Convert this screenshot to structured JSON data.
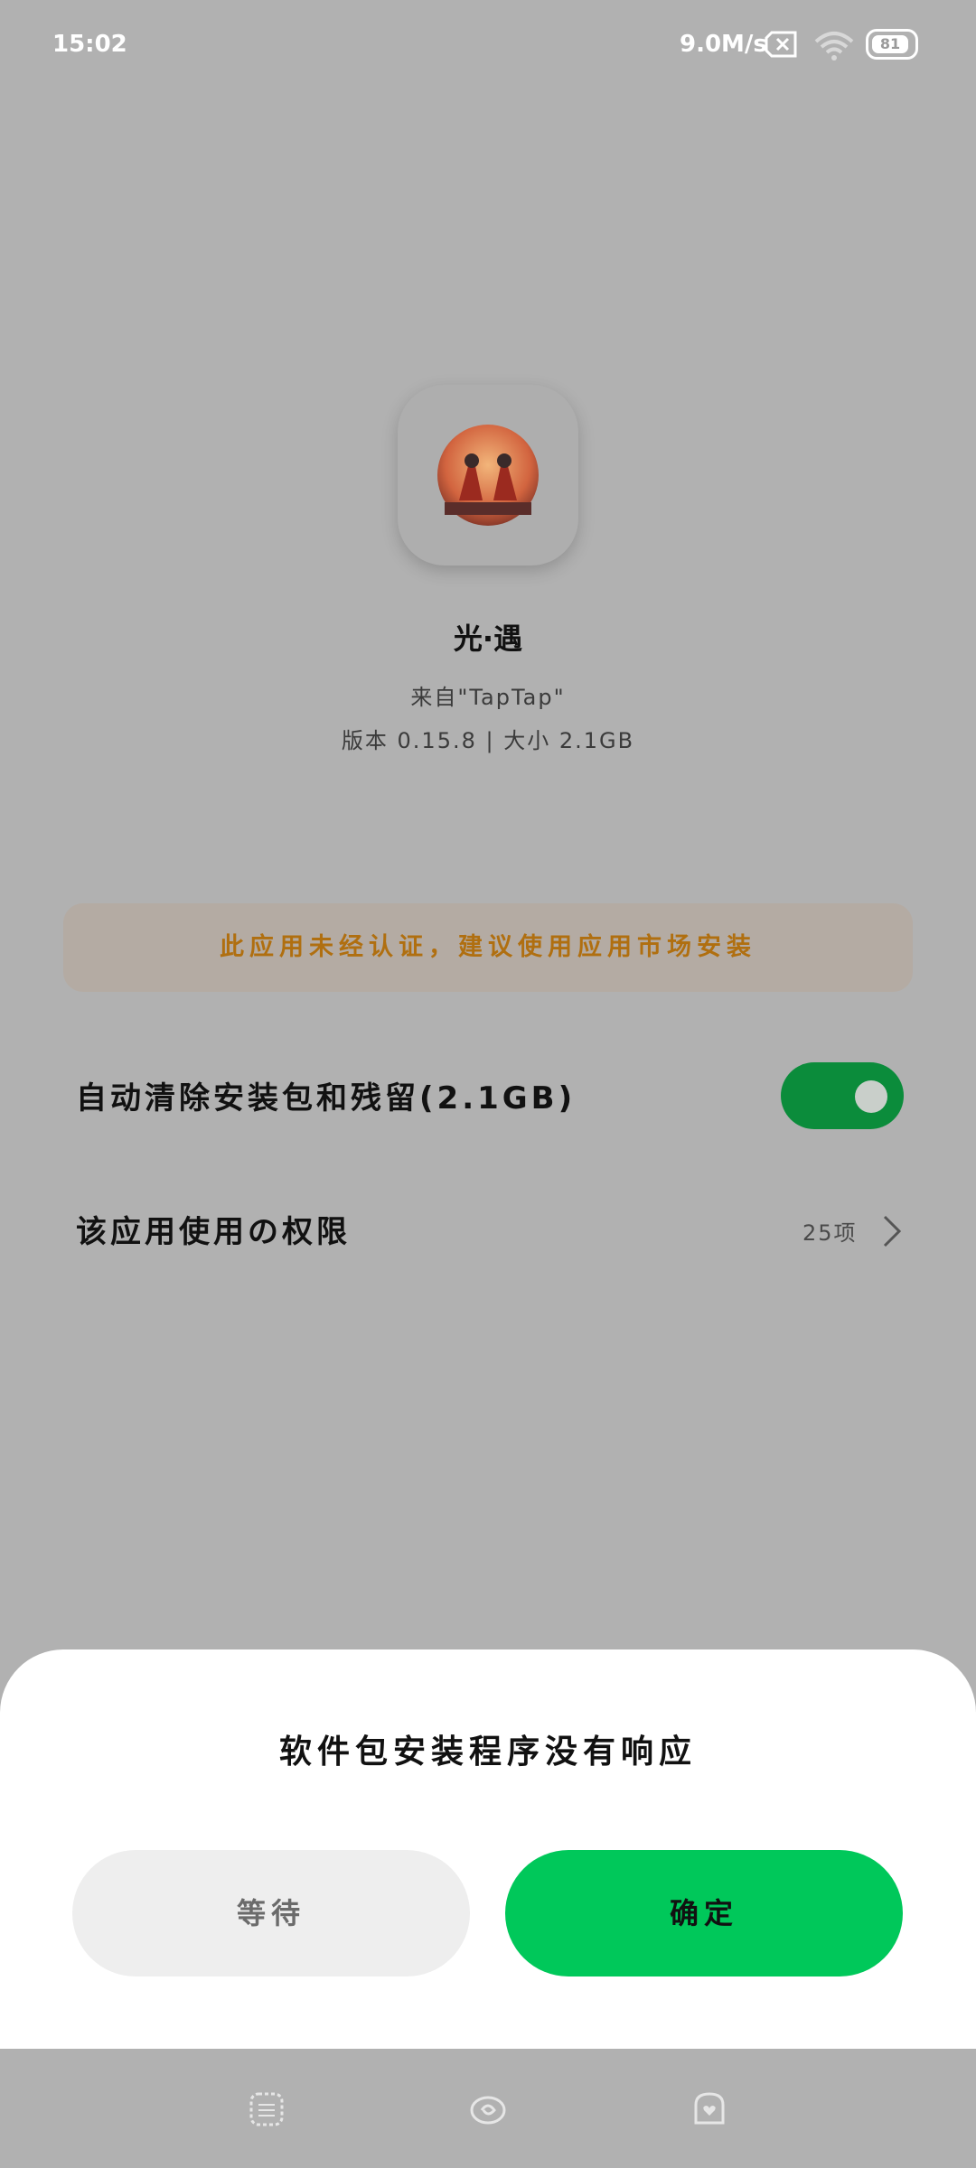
{
  "status_bar": {
    "time": "15:02",
    "network_speed": "9.0M/s",
    "battery": "81",
    "icons": [
      "sim-x-icon",
      "wifi-icon",
      "battery-icon"
    ]
  },
  "app": {
    "name": "光·遇",
    "source": "来自\"TapTap\"",
    "meta": "版本 0.15.8 | 大小 2.1GB",
    "icon": "app-icon"
  },
  "warning": {
    "text": "此应用未经认证，建议使用应用市场安装",
    "color": "#b06f10"
  },
  "settings": {
    "auto_clean_label": "自动清除安装包和残留(2.1GB)",
    "auto_clean_on": true,
    "permissions_label": "该应用使用の权限",
    "permissions_count": "25项"
  },
  "dialog": {
    "title": "软件包安装程序没有响应",
    "wait_label": "等待",
    "ok_label": "确定",
    "ok_color": "#00c85a"
  },
  "nav_bar": {
    "icons": [
      "menu-icon",
      "home-icon",
      "back-icon"
    ]
  }
}
